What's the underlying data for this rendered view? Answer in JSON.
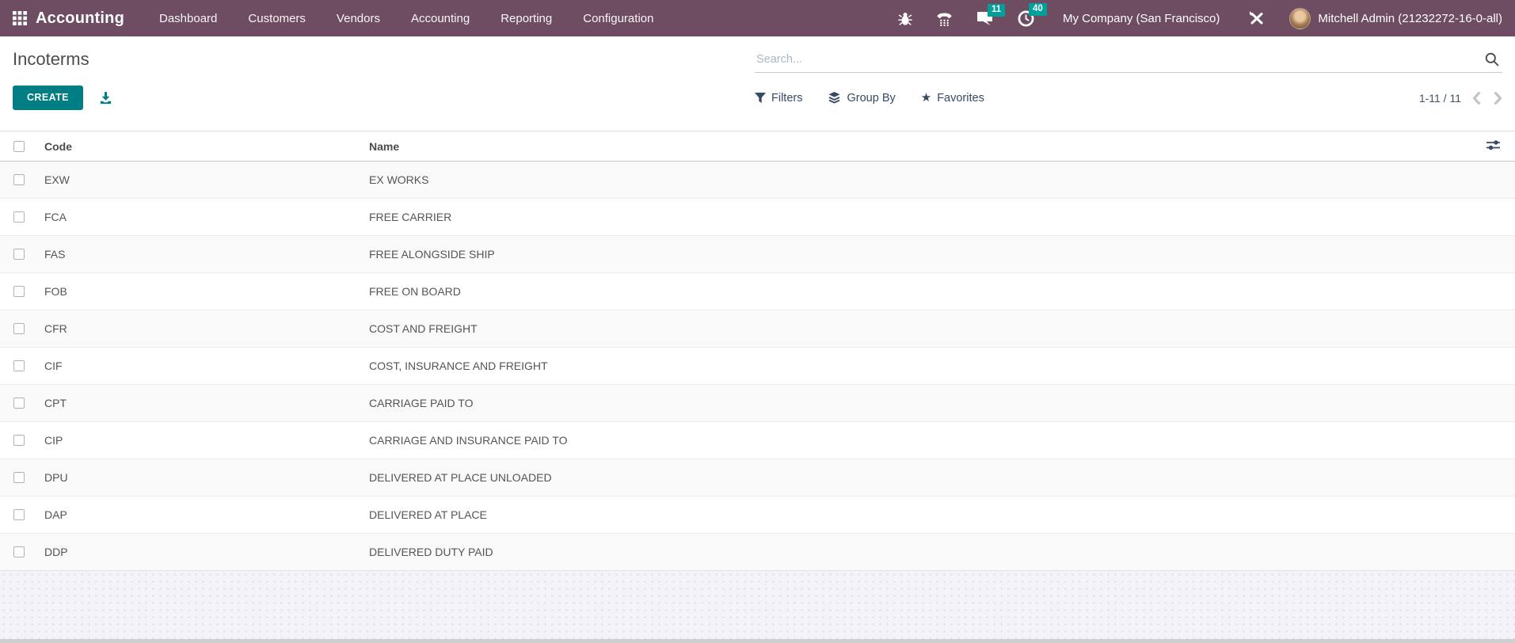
{
  "topbar": {
    "app_name": "Accounting",
    "menu": [
      "Dashboard",
      "Customers",
      "Vendors",
      "Accounting",
      "Reporting",
      "Configuration"
    ],
    "systray": {
      "messages_count": "11",
      "activities_count": "40",
      "company": "My Company (San Francisco)",
      "user": "Mitchell Admin (21232272-16-0-all)"
    }
  },
  "page": {
    "title": "Incoterms",
    "create_label": "CREATE",
    "search_placeholder": "Search...",
    "filters_label": "Filters",
    "group_by_label": "Group By",
    "favorites_label": "Favorites",
    "favorites_star": "★",
    "pager_range": "1-11 / 11"
  },
  "table": {
    "columns": {
      "code": "Code",
      "name": "Name"
    },
    "rows": [
      {
        "code": "EXW",
        "name": "EX WORKS"
      },
      {
        "code": "FCA",
        "name": "FREE CARRIER"
      },
      {
        "code": "FAS",
        "name": "FREE ALONGSIDE SHIP"
      },
      {
        "code": "FOB",
        "name": "FREE ON BOARD"
      },
      {
        "code": "CFR",
        "name": "COST AND FREIGHT"
      },
      {
        "code": "CIF",
        "name": "COST, INSURANCE AND FREIGHT"
      },
      {
        "code": "CPT",
        "name": "CARRIAGE PAID TO"
      },
      {
        "code": "CIP",
        "name": "CARRIAGE AND INSURANCE PAID TO"
      },
      {
        "code": "DPU",
        "name": "DELIVERED AT PLACE UNLOADED"
      },
      {
        "code": "DAP",
        "name": "DELIVERED AT PLACE"
      },
      {
        "code": "DDP",
        "name": "DELIVERED DUTY PAID"
      }
    ]
  },
  "colors": {
    "topbar_bg": "#6e4d62",
    "accent_teal": "#017e84",
    "badge_teal": "#00a09a",
    "facet_text": "#374a63"
  }
}
